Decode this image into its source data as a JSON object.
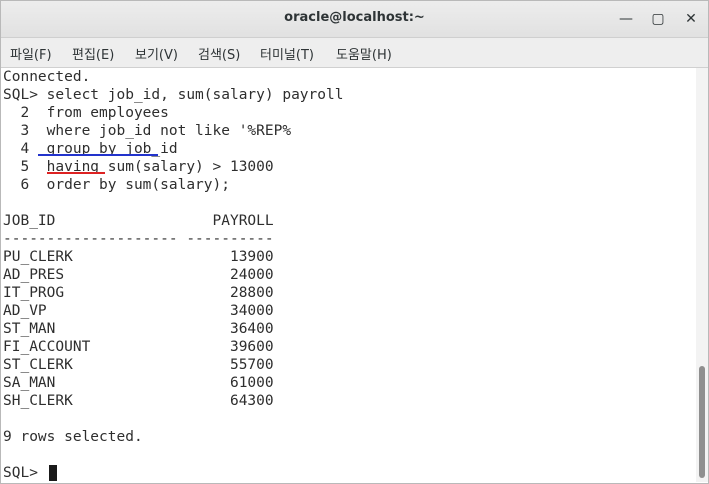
{
  "window": {
    "title": "oracle@localhost:~"
  },
  "menu": [
    "파일(F)",
    "편집(E)",
    "보기(V)",
    "검색(S)",
    "터미널(T)",
    "도움말(H)"
  ],
  "terminal": {
    "lines": [
      "Connected.",
      "SQL> select job_id, sum(salary) payroll",
      "  2  from employees",
      "  3  where job_id not like '%REP%",
      "  4  group by job_id",
      "  5  having sum(salary) > 13000",
      "  6  order by sum(salary);",
      "",
      "JOB_ID                  PAYROLL",
      "-------------------- ----------",
      "PU_CLERK                  13900",
      "AD_PRES                   24000",
      "IT_PROG                   28800",
      "AD_VP                     34000",
      "ST_MAN                    36400",
      "FI_ACCOUNT                39600",
      "ST_CLERK                  55700",
      "SA_MAN                    61000",
      "SH_CLERK                  64300",
      "",
      "9 rows selected.",
      "",
      "SQL> "
    ]
  }
}
